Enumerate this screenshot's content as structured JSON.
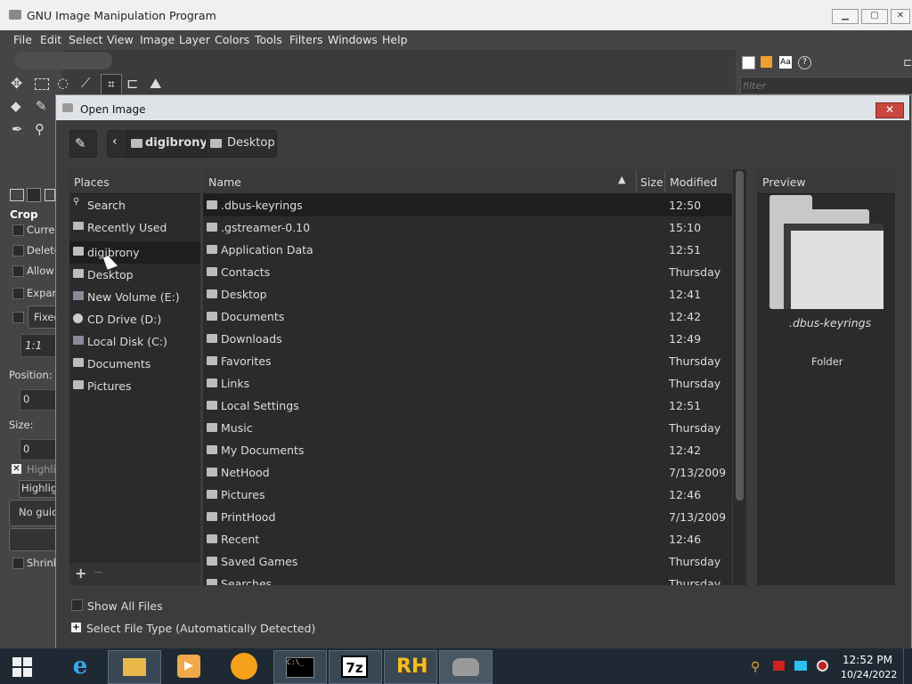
{
  "gimp": {
    "title": "GNU Image Manipulation Program",
    "menu": [
      "File",
      "Edit",
      "Select",
      "View",
      "Image",
      "Layer",
      "Colors",
      "Tools",
      "Filters",
      "Windows",
      "Help"
    ],
    "tool_options": {
      "crop": "Crop",
      "current": "Curren",
      "delete": "Delete",
      "allow": "Allow",
      "expand": "Expan",
      "fixed": "Fixed",
      "ratio": "1:1",
      "position_label": "Position:",
      "position_value": "0",
      "size_label": "Size:",
      "size_value": "0",
      "highlight": "Highli",
      "highlight_mode": "Highlig",
      "guides": "No guide",
      "shrink": "Shrink"
    },
    "dock_filter_placeholder": "filter"
  },
  "dialog": {
    "title": "Open Image",
    "close_label": "✕",
    "breadcrumbs": [
      "digibrony",
      "Desktop"
    ],
    "places_header": "Places",
    "places": [
      {
        "label": "Search",
        "icon": "search-icon"
      },
      {
        "label": "Recently Used",
        "icon": "clock-icon"
      },
      {
        "label": "digibrony",
        "icon": "folder-icon"
      },
      {
        "label": "Desktop",
        "icon": "folder-icon"
      },
      {
        "label": "New Volume (E:)",
        "icon": "drive-icon"
      },
      {
        "label": "CD Drive (D:)",
        "icon": "cd-icon"
      },
      {
        "label": "Local Disk (C:)",
        "icon": "drive-icon"
      },
      {
        "label": "Documents",
        "icon": "folder-icon"
      },
      {
        "label": "Pictures",
        "icon": "folder-icon"
      }
    ],
    "columns": {
      "name": "Name",
      "size": "Size",
      "modified": "Modified"
    },
    "files": [
      {
        "name": ".dbus-keyrings",
        "modified": "12:50"
      },
      {
        "name": ".gstreamer-0.10",
        "modified": "15:10"
      },
      {
        "name": "Application Data",
        "modified": "12:51"
      },
      {
        "name": "Contacts",
        "modified": "Thursday"
      },
      {
        "name": "Desktop",
        "modified": "12:41"
      },
      {
        "name": "Documents",
        "modified": "12:42"
      },
      {
        "name": "Downloads",
        "modified": "12:49"
      },
      {
        "name": "Favorites",
        "modified": "Thursday"
      },
      {
        "name": "Links",
        "modified": "Thursday"
      },
      {
        "name": "Local Settings",
        "modified": "12:51"
      },
      {
        "name": "Music",
        "modified": "Thursday"
      },
      {
        "name": "My Documents",
        "modified": "12:42"
      },
      {
        "name": "NetHood",
        "modified": "7/13/2009"
      },
      {
        "name": "Pictures",
        "modified": "12:46"
      },
      {
        "name": "PrintHood",
        "modified": "7/13/2009"
      },
      {
        "name": "Recent",
        "modified": "12:46"
      },
      {
        "name": "Saved Games",
        "modified": "Thursday"
      },
      {
        "name": "Searches",
        "modified": "Thursday"
      }
    ],
    "preview_header": "Preview",
    "preview_name": ".dbus-keyrings",
    "preview_type": "Folder",
    "show_all_files": "Show All Files",
    "select_file_type": "Select File Type (Automatically Detected)",
    "add_label": "+",
    "remove_label": "—"
  },
  "taskbar": {
    "time": "12:52 PM",
    "date": "10/24/2022",
    "apps": [
      "ie-icon",
      "explorer-icon",
      "media-player-icon",
      "browser-icon",
      "cmd-icon",
      "7zip-icon",
      "rh-icon",
      "gimp-icon"
    ],
    "app_labels": {
      "cmd": "C:\\_",
      "sevenzip": "7z",
      "rh": "RH"
    }
  }
}
